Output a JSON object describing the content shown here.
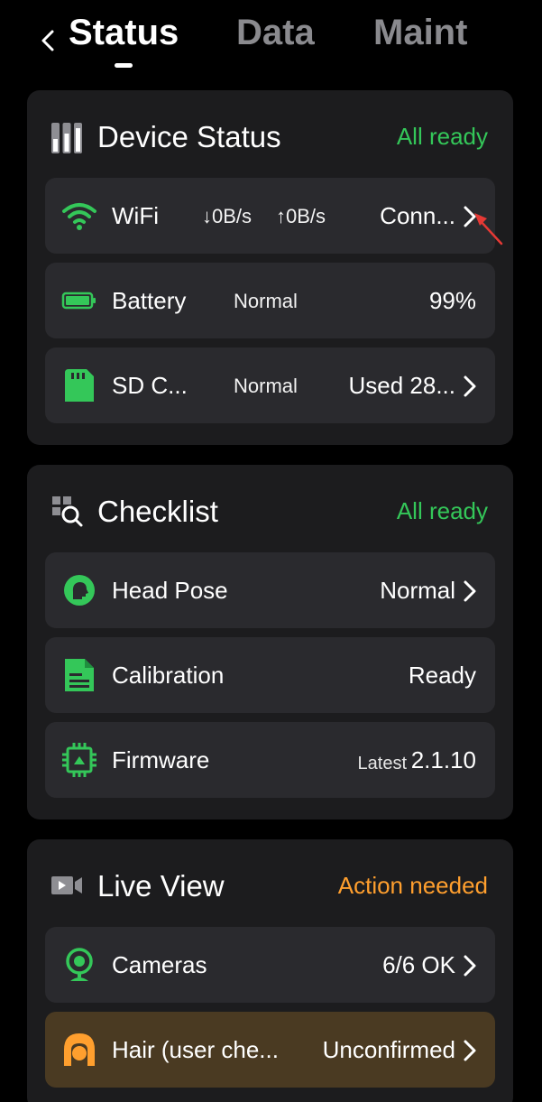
{
  "header": {
    "tabs": [
      {
        "label": "Status",
        "active": true
      },
      {
        "label": "Data",
        "active": false
      },
      {
        "label": "Maint",
        "active": false
      }
    ]
  },
  "colors": {
    "ok": "#34c759",
    "warn": "#ff9f2e",
    "card_bg": "#1c1c1e",
    "row_bg": "#2a2a2e",
    "row_warn_bg": "#4a3a22"
  },
  "device_status": {
    "title": "Device Status",
    "state": "All ready",
    "icon": "equalizer-icon",
    "rows": {
      "wifi": {
        "label": "WiFi",
        "down": "↓0B/s",
        "up": "↑0B/s",
        "value": "Conn...",
        "icon": "wifi-icon"
      },
      "battery": {
        "label": "Battery",
        "status": "Normal",
        "value": "99%",
        "icon": "battery-icon"
      },
      "sd": {
        "label": "SD C...",
        "status": "Normal",
        "value": "Used 28...",
        "icon": "sd-card-icon"
      }
    }
  },
  "checklist": {
    "title": "Checklist",
    "state": "All ready",
    "icon": "checklist-search-icon",
    "rows": {
      "head_pose": {
        "label": "Head Pose",
        "value": "Normal",
        "icon": "head-icon"
      },
      "calibration": {
        "label": "Calibration",
        "value": "Ready",
        "icon": "document-icon"
      },
      "firmware": {
        "label": "Firmware",
        "prefix": "Latest",
        "value": "2.1.10",
        "icon": "chip-icon"
      }
    }
  },
  "live_view": {
    "title": "Live View",
    "state": "Action needed",
    "icon": "video-camera-icon",
    "rows": {
      "cameras": {
        "label": "Cameras",
        "value": "6/6 OK",
        "icon": "webcam-icon"
      },
      "hair": {
        "label": "Hair (user che...",
        "value": "Unconfirmed",
        "icon": "hair-icon"
      }
    }
  }
}
